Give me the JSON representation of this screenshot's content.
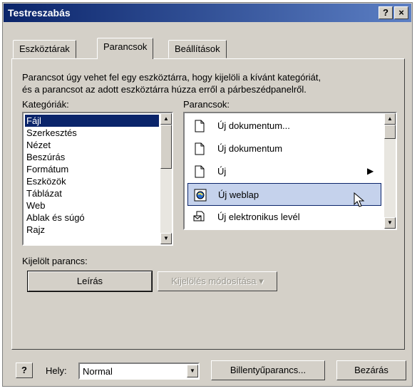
{
  "window": {
    "title": "Testreszabás",
    "help_btn": "?",
    "close_btn": "×"
  },
  "tabs": [
    {
      "label": "Eszköztárak",
      "active": false
    },
    {
      "label": "Parancsok",
      "active": true
    },
    {
      "label": "Beállítások",
      "active": false
    }
  ],
  "description": {
    "line1": "Parancsot úgy vehet fel egy eszköztárra, hogy kijelöli a kívánt kategóriát,",
    "line2": "és a parancsot az adott eszköztárra húzza erről a párbeszédpanelről."
  },
  "categories": {
    "label": "Kategóriák:",
    "items": [
      "Fájl",
      "Szerkesztés",
      "Nézet",
      "Beszúrás",
      "Formátum",
      "Eszközök",
      "Táblázat",
      "Web",
      "Ablak és súgó",
      "Rajz"
    ],
    "selected": "Fájl"
  },
  "commands": {
    "label": "Parancsok:",
    "items": [
      {
        "label": "Új dokumentum...",
        "icon": "document-icon",
        "selected": false
      },
      {
        "label": "Új dokumentum",
        "icon": "document-icon",
        "selected": false
      },
      {
        "label": "Új",
        "icon": "document-icon",
        "submenu_glyph": "▶",
        "selected": false
      },
      {
        "label": "Új weblap",
        "icon": "webpage-icon",
        "selected": true
      },
      {
        "label": "Új elektronikus levél",
        "icon": "email-icon",
        "selected": false
      }
    ]
  },
  "selected_command": {
    "label": "Kijelölt parancs:",
    "description_button": "Leírás",
    "modify_button": "Kijelölés módosítása",
    "modify_arrow": "▾"
  },
  "footer": {
    "help_icon_glyph": "?",
    "location_label": "Hely:",
    "location_value": "Normal",
    "keyboard_button": "Billentyűparancs...",
    "close_button": "Bezárás"
  },
  "colors": {
    "selection": "#0a246a",
    "title_gradient_end": "#5c7fc4",
    "dialog_face": "#d4d0c8"
  }
}
